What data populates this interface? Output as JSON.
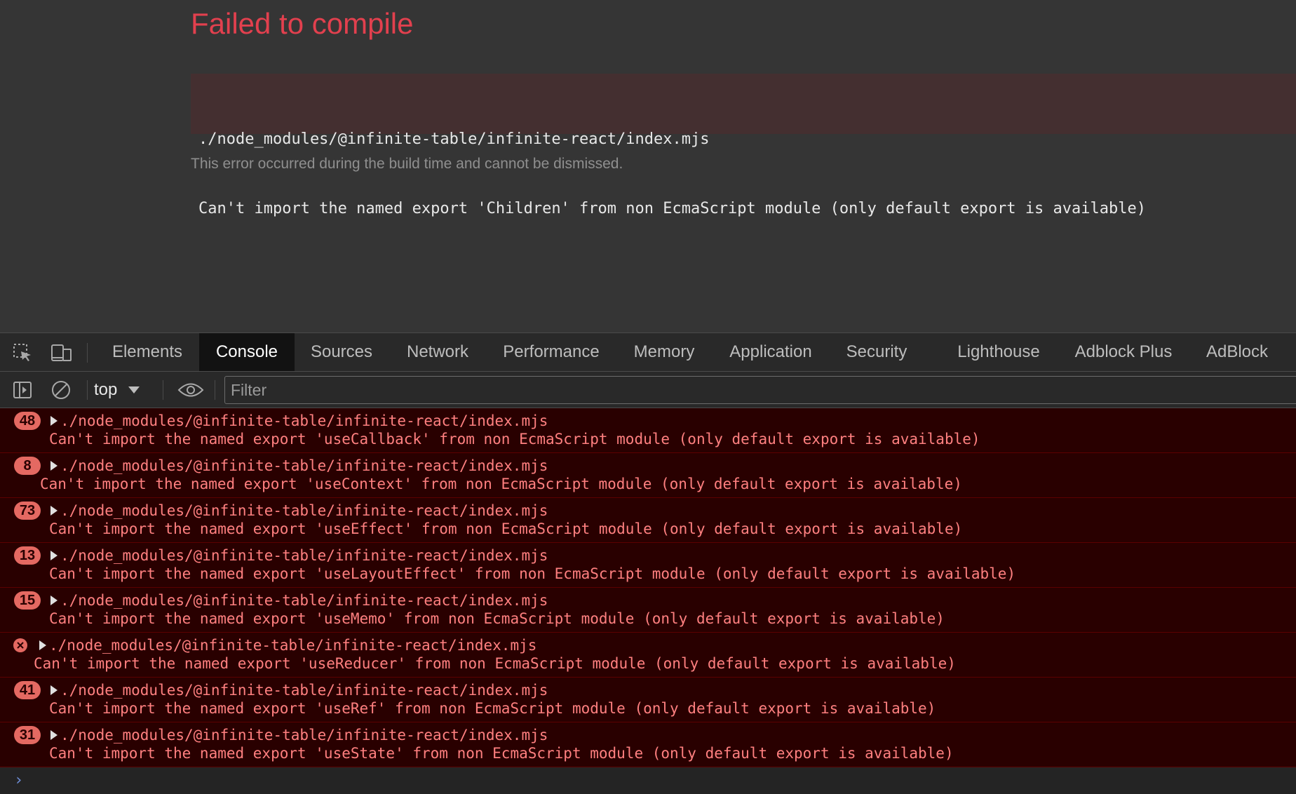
{
  "overlay": {
    "title": "Failed to compile",
    "code_lines": [
      "./node_modules/@infinite-table/infinite-react/index.mjs",
      "Can't import the named export 'Children' from non EcmaScript module (only default export is available)"
    ],
    "note": "This error occurred during the build time and cannot be dismissed."
  },
  "tabbar": {
    "tabs": [
      {
        "label": "Elements"
      },
      {
        "label": "Console",
        "active": true
      },
      {
        "label": "Sources"
      },
      {
        "label": "Network"
      },
      {
        "label": "Performance"
      },
      {
        "label": "Memory"
      },
      {
        "label": "Application"
      },
      {
        "label": "Security"
      },
      {
        "label": "Lighthouse"
      },
      {
        "label": "Adblock Plus"
      },
      {
        "label": "AdBlock"
      }
    ]
  },
  "console_toolbar": {
    "context": "top",
    "filter_placeholder": "Filter"
  },
  "messages": [
    {
      "count": "48",
      "path": "./node_modules/@infinite-table/infinite-react/index.mjs",
      "text": "Can't import the named export 'useCallback' from non EcmaScript module (only default export is available)"
    },
    {
      "count": "8",
      "path": "./node_modules/@infinite-table/infinite-react/index.mjs",
      "text": "Can't import the named export 'useContext' from non EcmaScript module (only default export is available)"
    },
    {
      "count": "73",
      "path": "./node_modules/@infinite-table/infinite-react/index.mjs",
      "text": "Can't import the named export 'useEffect' from non EcmaScript module (only default export is available)"
    },
    {
      "count": "13",
      "path": "./node_modules/@infinite-table/infinite-react/index.mjs",
      "text": "Can't import the named export 'useLayoutEffect' from non EcmaScript module (only default export is available)"
    },
    {
      "count": "15",
      "path": "./node_modules/@infinite-table/infinite-react/index.mjs",
      "text": "Can't import the named export 'useMemo' from non EcmaScript module (only default export is available)"
    },
    {
      "count": "",
      "path": "./node_modules/@infinite-table/infinite-react/index.mjs",
      "text": "Can't import the named export 'useReducer' from non EcmaScript module (only default export is available)"
    },
    {
      "count": "41",
      "path": "./node_modules/@infinite-table/infinite-react/index.mjs",
      "text": "Can't import the named export 'useRef' from non EcmaScript module (only default export is available)"
    },
    {
      "count": "31",
      "path": "./node_modules/@infinite-table/infinite-react/index.mjs",
      "text": "Can't import the named export 'useState' from non EcmaScript module (only default export is available)"
    }
  ],
  "prompt": {
    "chevron": "›"
  },
  "colors": {
    "error_text": "#ff8080",
    "error_bg": "#290000",
    "badge": "#e46962",
    "overlay_title": "#e2404e"
  }
}
